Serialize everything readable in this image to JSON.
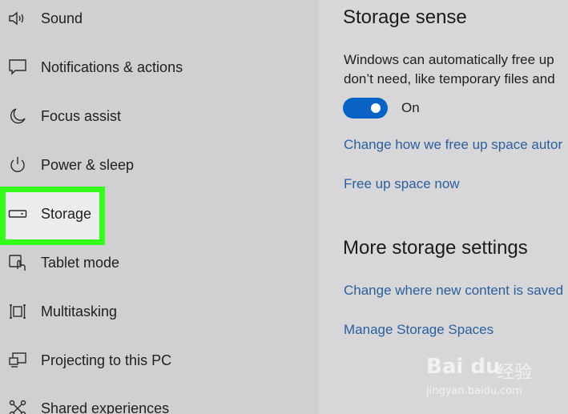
{
  "sidebar": {
    "items": [
      {
        "label": "Sound",
        "icon": "speaker-icon"
      },
      {
        "label": "Notifications & actions",
        "icon": "notification-icon"
      },
      {
        "label": "Focus assist",
        "icon": "moon-icon"
      },
      {
        "label": "Power & sleep",
        "icon": "power-icon"
      },
      {
        "label": "Storage",
        "icon": "storage-drive-icon",
        "selected": true
      },
      {
        "label": "Tablet mode",
        "icon": "tablet-mode-icon"
      },
      {
        "label": "Multitasking",
        "icon": "multitasking-icon"
      },
      {
        "label": "Projecting to this PC",
        "icon": "projecting-icon"
      },
      {
        "label": "Shared experiences",
        "icon": "shared-experiences-icon"
      }
    ]
  },
  "main": {
    "storage_sense": {
      "title": "Storage sense",
      "description_line1": "Windows can automatically free up",
      "description_line2": "don’t need, like temporary files and",
      "toggle_state": "On",
      "link_change": "Change how we free up space autor",
      "link_free": "Free up space now"
    },
    "more_settings": {
      "title": "More storage settings",
      "link_new_content": "Change where new content is saved",
      "link_spaces": "Manage Storage Spaces"
    }
  },
  "watermark": {
    "logo_text": "Bai du",
    "cn_text": "经验",
    "url": "jingyan.baidu.com"
  },
  "colors": {
    "highlight": "#33ff1a",
    "link": "#2b5f9c",
    "toggle_on": "#0a62c4",
    "sidebar_bg": "#d0d0d3",
    "main_bg": "#d7d7d9"
  }
}
